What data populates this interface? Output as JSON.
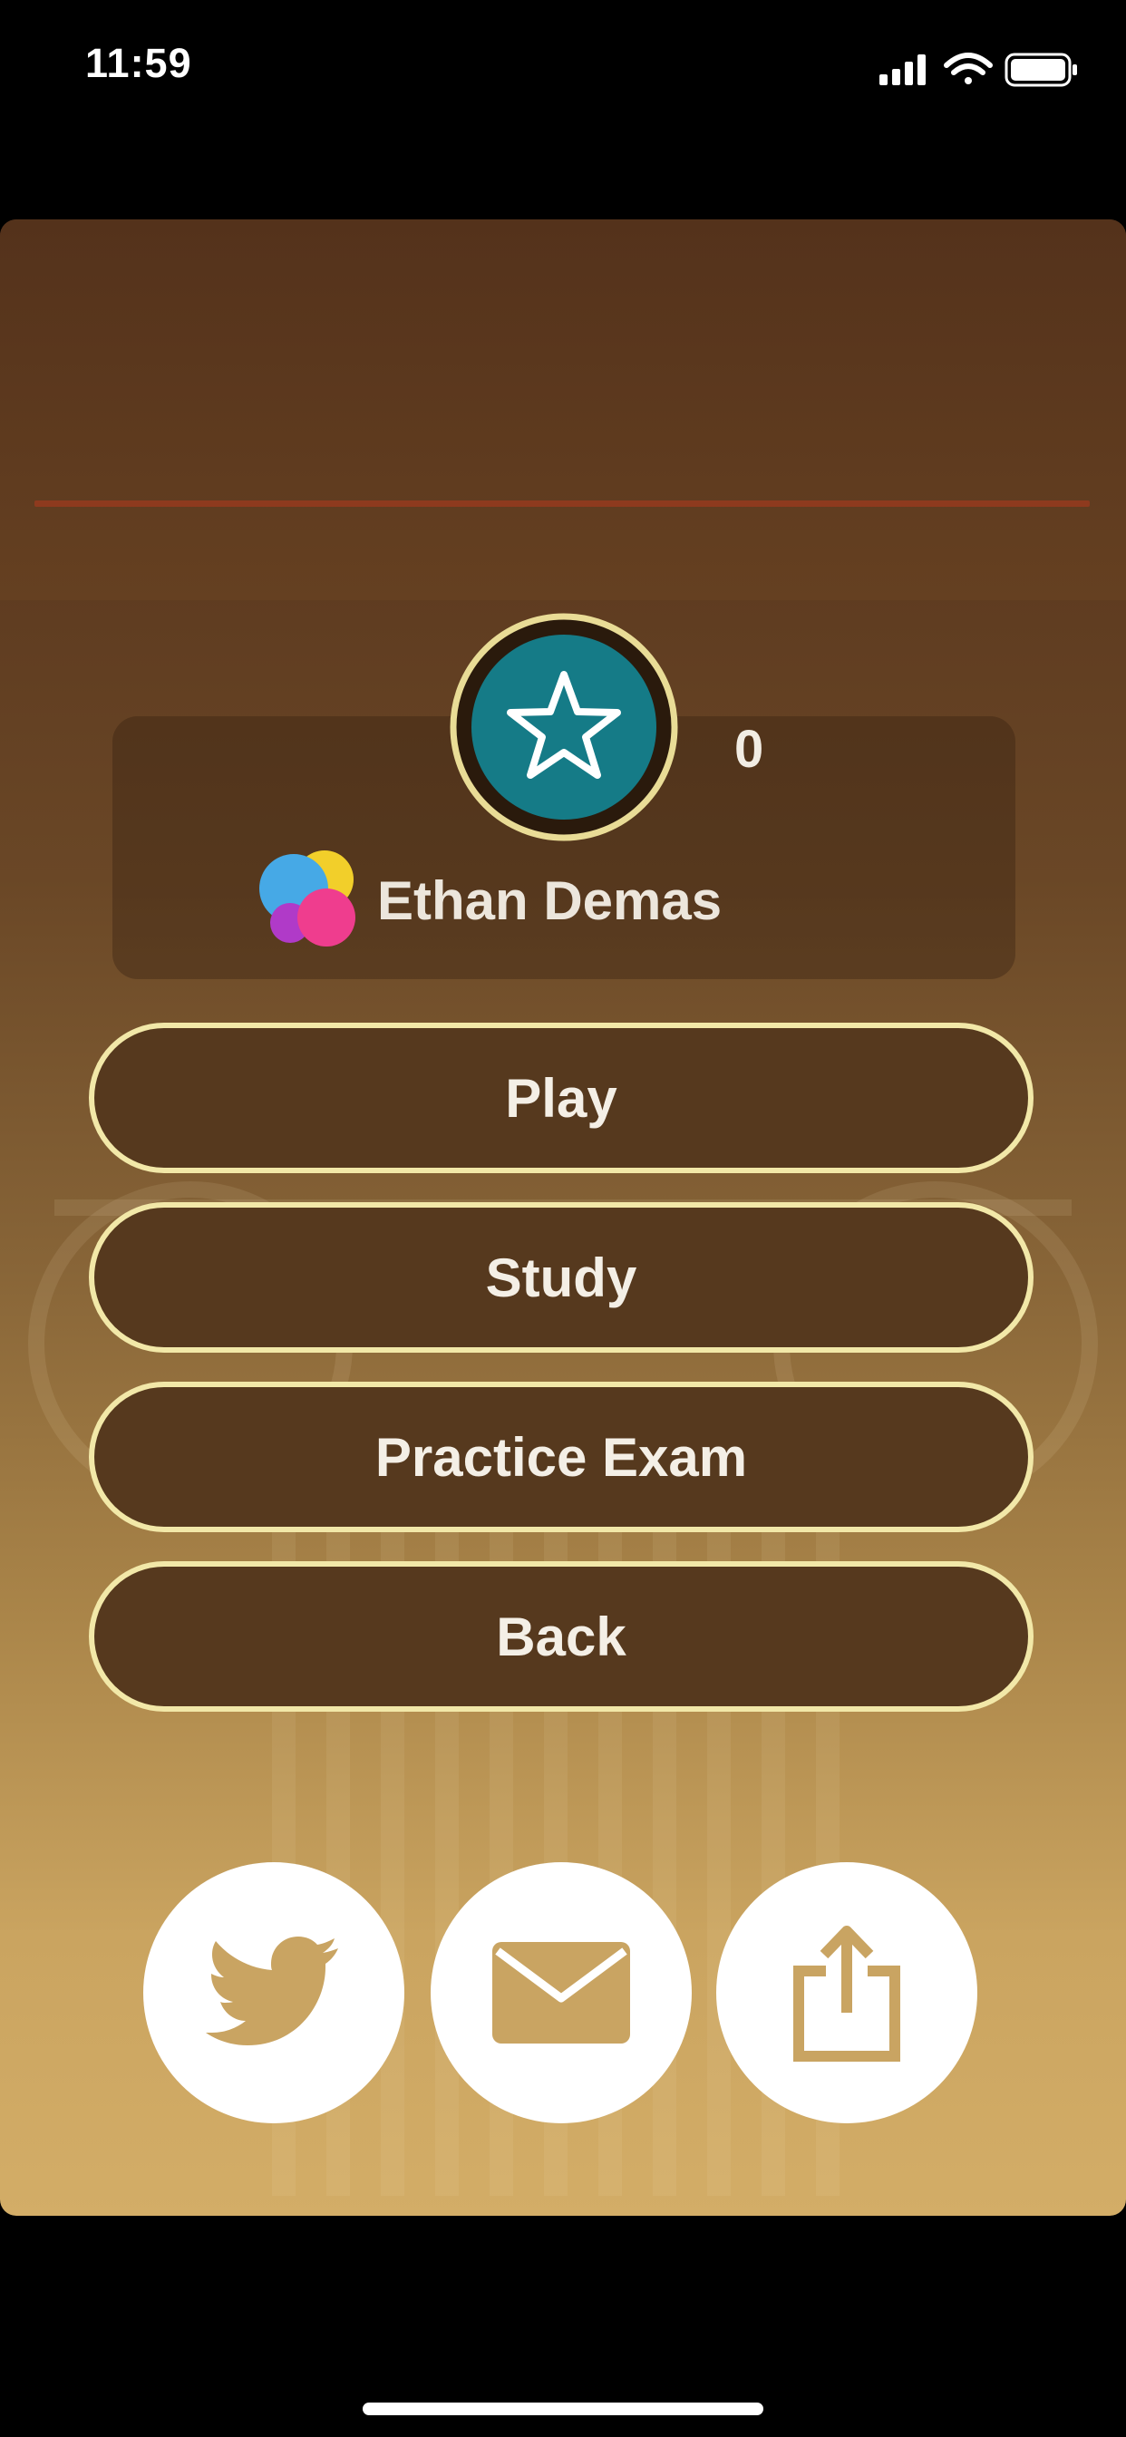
{
  "status_bar": {
    "time": "11:59"
  },
  "player": {
    "score": "0",
    "name": "Ethan Demas"
  },
  "menu": {
    "play_label": "Play",
    "study_label": "Study",
    "practice_exam_label": "Practice Exam",
    "back_label": "Back"
  },
  "share": {
    "icons": [
      "twitter-icon",
      "mail-icon",
      "share-icon"
    ]
  },
  "colors": {
    "button_fill": "#56391e",
    "button_border": "#f2e8a8",
    "badge_teal": "#157b87",
    "accent_gold": "#d3ad67",
    "top_rule": "#8e3a1e"
  }
}
